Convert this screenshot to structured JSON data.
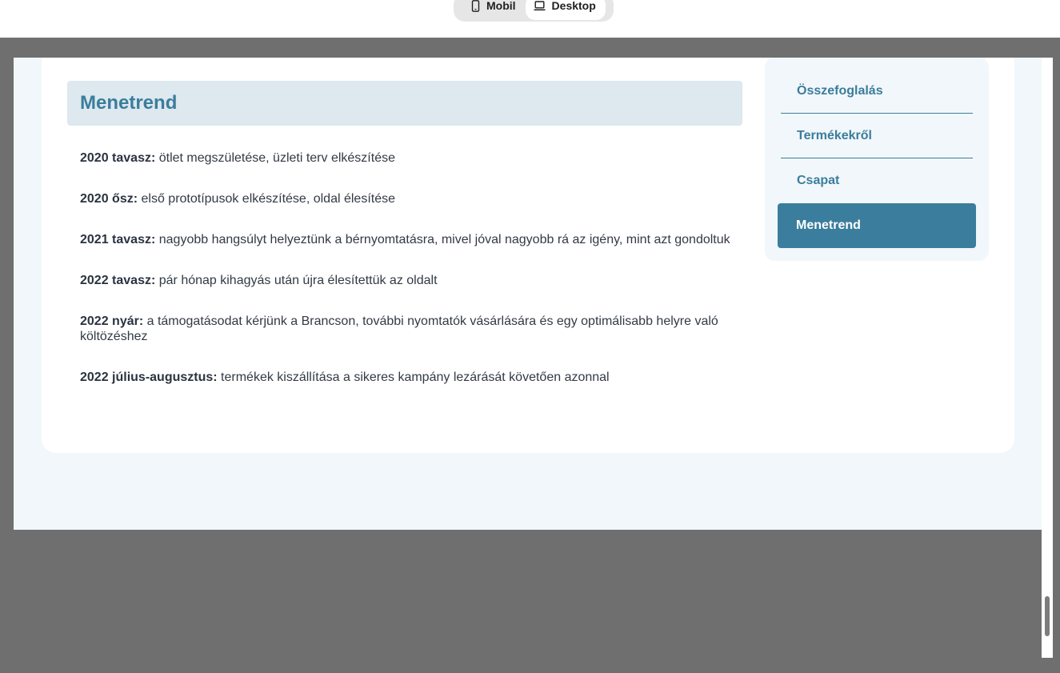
{
  "toolbar": {
    "mobile_label": "Mobil",
    "desktop_label": "Desktop",
    "active_view": "Desktop"
  },
  "section": {
    "title": "Menetrend"
  },
  "timeline": [
    {
      "period": "2020 tavasz:",
      "text": " ötlet megszületése, üzleti terv elkészítése"
    },
    {
      "period": "2020 ősz:",
      "text": " első prototípusok elkészítése, oldal élesítése"
    },
    {
      "period": "2021 tavasz:",
      "text": " nagyobb hangsúlyt helyeztünk a bérnyomtatásra, mivel jóval nagyobb rá az igény, mint azt gondoltuk"
    },
    {
      "period": "2022 tavasz:",
      "text": " pár hónap kihagyás után újra élesítettük az oldalt"
    },
    {
      "period": "2022 nyár:",
      "text": " a támogatásodat kérjünk a Brancson, további nyomtatók vásárlására és egy optimálisabb helyre való költözéshez"
    },
    {
      "period": "2022 július-augusztus:",
      "text": " termékek kiszállítása a sikeres kampány lezárását követően azonnal"
    }
  ],
  "sidebar": {
    "items": [
      {
        "label": "Összefoglalás"
      },
      {
        "label": "Termékekről"
      },
      {
        "label": "Csapat"
      },
      {
        "label": "Menetrend"
      }
    ],
    "active_item": "Menetrend"
  },
  "colors": {
    "accent": "#3b7d9c",
    "header_bg": "#dde8ef",
    "page_bg": "#f1f7fa",
    "backdrop": "#6f6f6f"
  }
}
